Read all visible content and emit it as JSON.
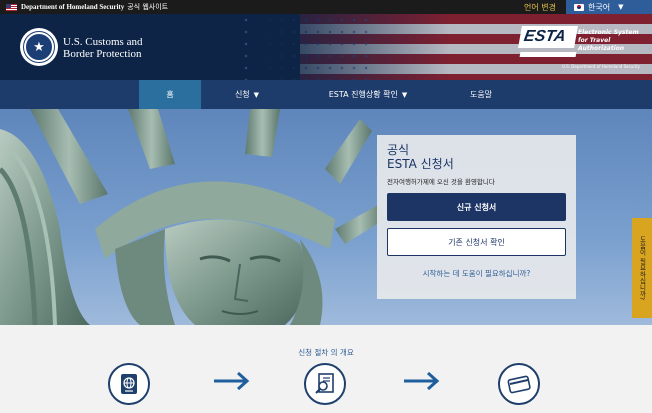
{
  "govbar": {
    "text": "Department of Homeland Security",
    "text2": "공식 웹사이트"
  },
  "language": {
    "change_label": "언어 변경",
    "selected": "한국어"
  },
  "header": {
    "agency_line1": "U.S. Customs and",
    "agency_line2": "Border Protection",
    "esta_logo": "ESTA",
    "esta_subtitle": "Electronic System for Travel Authorization",
    "esta_dept": "U.S. Department of Homeland Security"
  },
  "nav": [
    {
      "label": "홈",
      "active": true
    },
    {
      "label": "신청",
      "dropdown": true
    },
    {
      "label": "ESTA 진행상황 확인",
      "dropdown": true
    },
    {
      "label": "도움말"
    }
  ],
  "panel": {
    "title_line1": "공식",
    "title_line2": "ESTA 신청서",
    "welcome": "전자여행허가제에 오신 것을 환영합니다",
    "new_button": "신규 신청서",
    "existing_button": "기존 신청서 확인",
    "help_link": "시작하는 데 도움이 필요하십니까?"
  },
  "sidetab": {
    "label": "도움이 필요하십니까?"
  },
  "process": {
    "title": "신청 절차 의 개요",
    "steps": [
      {
        "icon": "passport-icon"
      },
      {
        "icon": "application-search-icon"
      },
      {
        "icon": "credit-card-icon"
      }
    ]
  },
  "colors": {
    "navy": "#1e3c6b",
    "active_nav": "#2a6f9e",
    "gold": "#d9a520",
    "link": "#2d5d95"
  }
}
